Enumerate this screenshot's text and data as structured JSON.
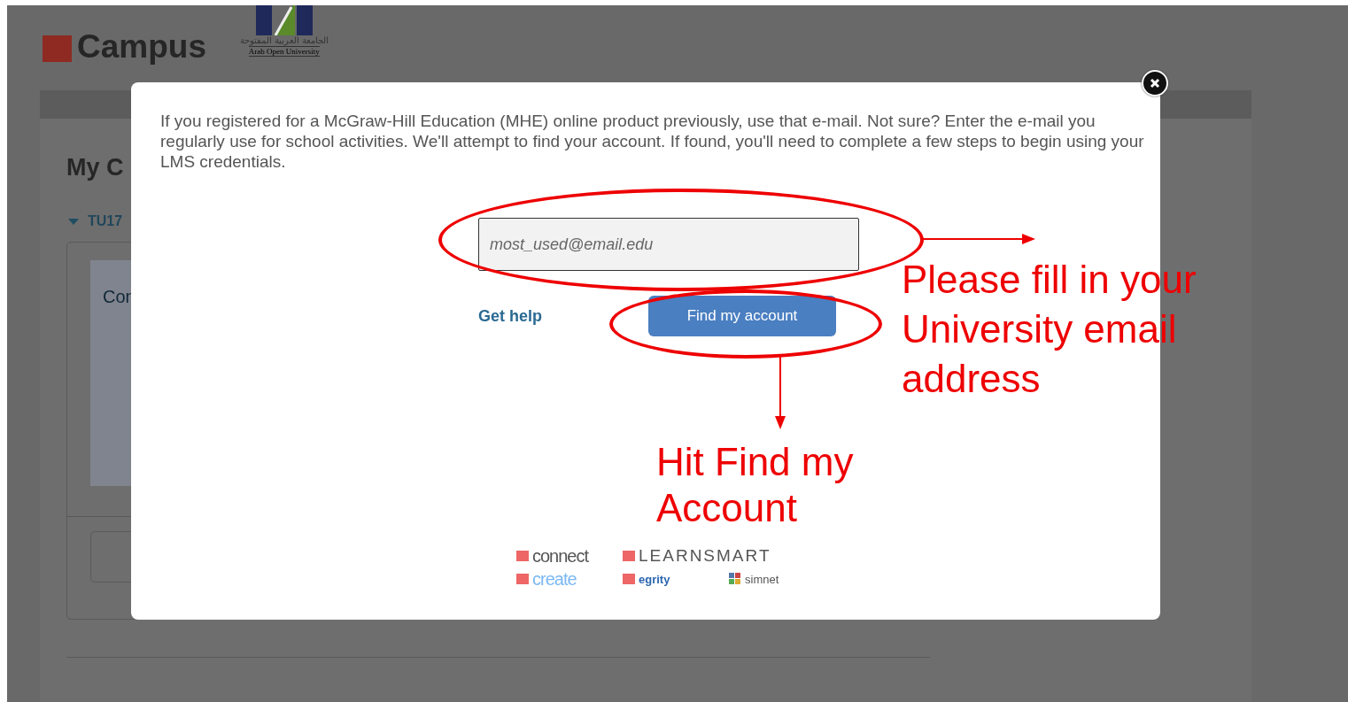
{
  "header": {
    "logo_text": "Campus",
    "university_arabic": "الجامعة العربية المفتوحة",
    "university_name": "Arab Open University"
  },
  "background": {
    "heading": "My C",
    "course_code": "TU17",
    "course_title": "Con"
  },
  "modal": {
    "message": "If you registered for a McGraw-Hill Education (MHE) online product previously, use that e-mail. Not sure? Enter the e-mail you regularly use for school activities. We'll attempt to find your account. If found, you'll need to complete a few steps to begin using your LMS credentials.",
    "email_field": {
      "placeholder": "most_used@email.edu"
    },
    "help_link": "Get help",
    "submit_button": "Find my account",
    "product_logos": [
      {
        "kind": "connect",
        "text": "connect"
      },
      {
        "kind": "learnsmart",
        "text": "LEARNSMART"
      },
      {
        "kind": "create",
        "text": "create"
      },
      {
        "kind": "tegrity",
        "text": "egrity"
      },
      {
        "kind": "simnet",
        "text": "simnet"
      }
    ]
  },
  "annotations": [
    {
      "kind": "field",
      "text": "Please fill in your University email address"
    },
    {
      "kind": "button",
      "text": "Hit Find my Account"
    }
  ]
}
